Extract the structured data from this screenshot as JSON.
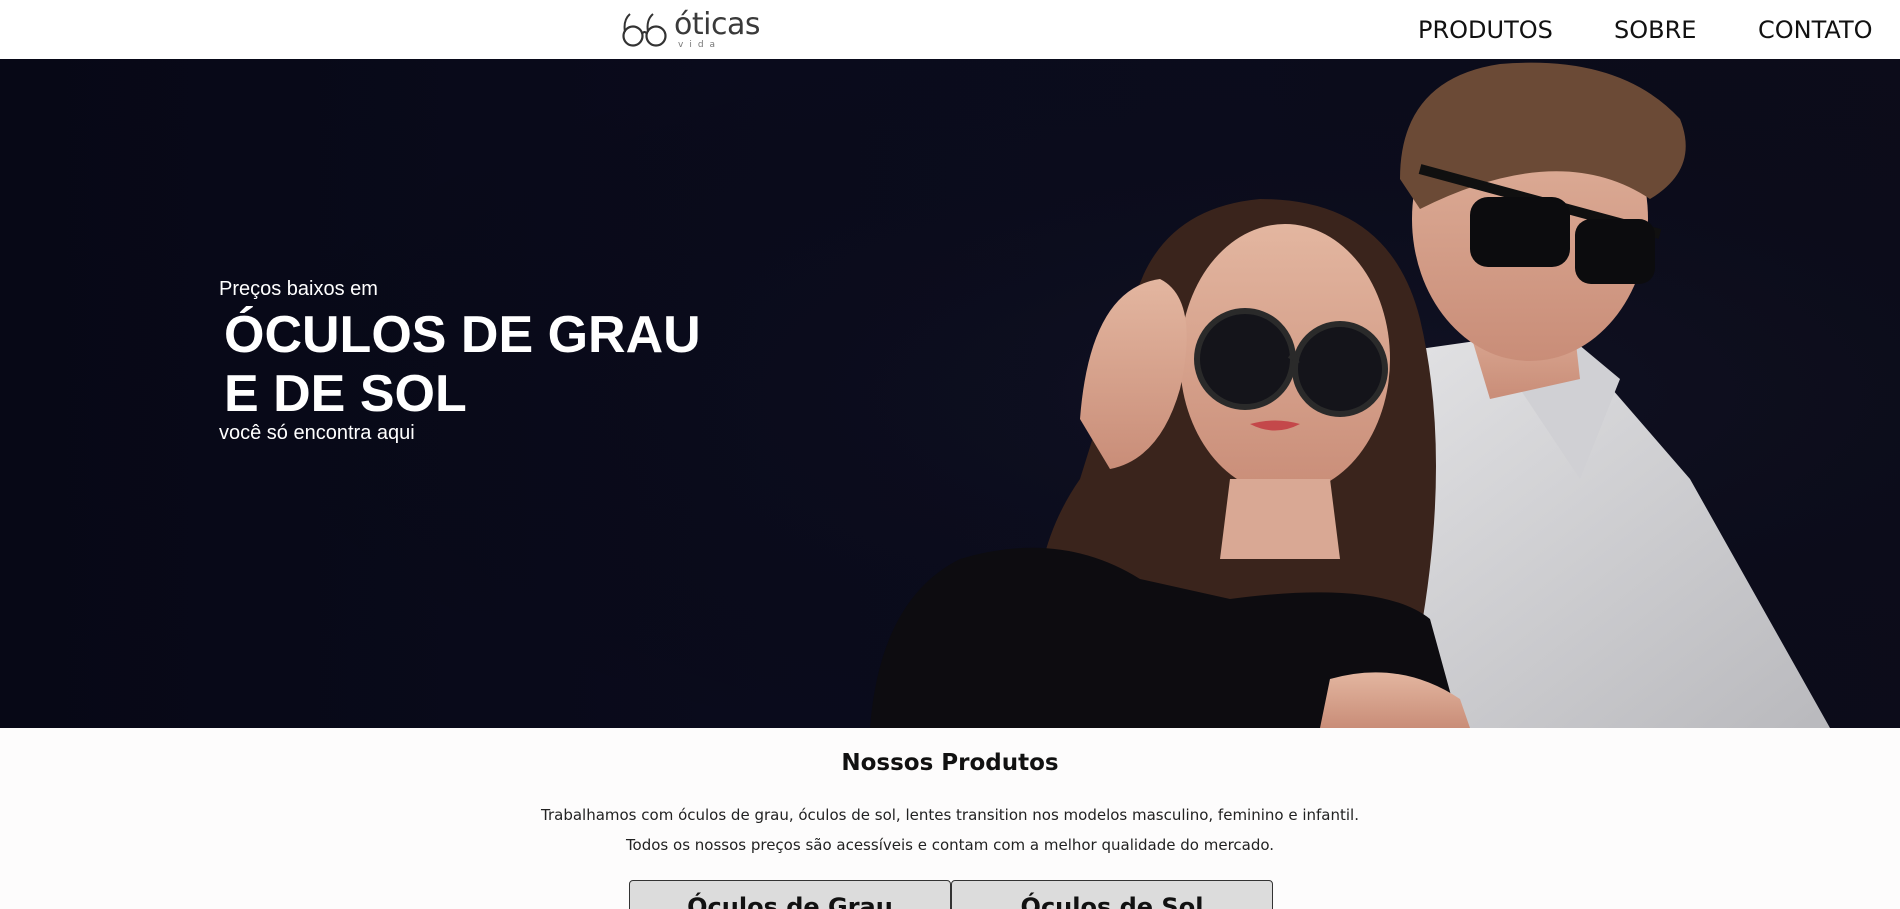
{
  "header": {
    "logo": {
      "word": "óticas",
      "sub": "vida"
    },
    "nav": [
      {
        "label": "PRODUTOS"
      },
      {
        "label": "SOBRE"
      },
      {
        "label": "CONTATO"
      }
    ]
  },
  "hero": {
    "pre": "Preços baixos em",
    "title_line1": "ÓCULOS DE GRAU",
    "title_line2": "E DE SOL",
    "sub": "você só encontra aqui"
  },
  "products": {
    "title": "Nossos Produtos",
    "desc_line1": "Trabalhamos com óculos de grau, óculos de sol, lentes transition nos modelos masculino, feminino e infantil.",
    "desc_line2": "Todos os nossos preços são acessíveis e contam com a melhor qualidade do mercado.",
    "buttons": [
      {
        "label": "Óculos de Grau"
      },
      {
        "label": "Óculos de Sol"
      }
    ]
  },
  "colors": {
    "hero_bg": "#0a0b1c",
    "header_bg": "#ffffff",
    "button_bg": "#dcdcdc"
  }
}
